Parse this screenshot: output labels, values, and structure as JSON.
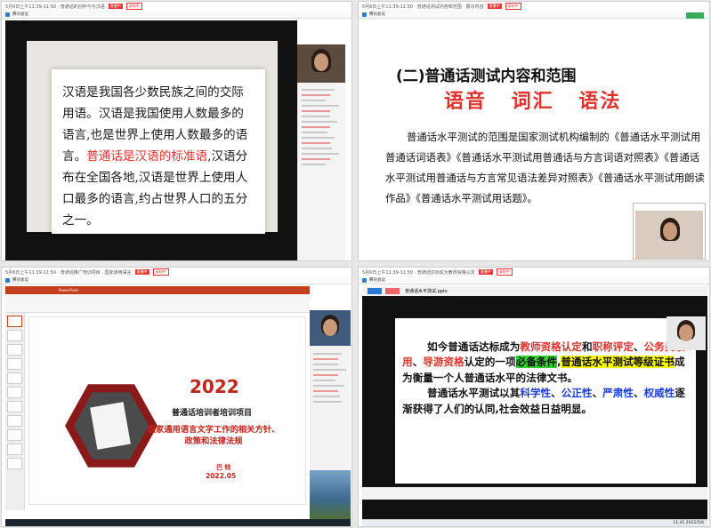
{
  "captions": {
    "q1": "5月6日上午11:39-11:50 · 普通话的创作与与汉语",
    "q1_tag": "直播中",
    "q1_tag2": "录制中",
    "q2": "5月6日上午11:39-11:50 · 普通话测试内容和范围 · 展示内容",
    "q2_tag": "直播中",
    "q2_tag2": "录制中",
    "q3": "5月6日上午11:39-11:50 · 普通话推广培训项目 · 国家通用语言",
    "q3_tag": "直播中",
    "q3_tag2": "录制中",
    "q4": "5月6日上午11:39-11:50 · 普通话达标成为教师资格认定",
    "q4_tag": "直播中",
    "q4_tag2": "录制中"
  },
  "window_title": "腾讯会议",
  "q1": {
    "lines": [
      {
        "text": "汉语是我国各少数民族之间的交际用",
        "red": false
      },
      {
        "text": "语。汉语是我国使用人数最多的语言,",
        "red": false
      },
      {
        "text": "也是世界上使用人数最多的语言。",
        "red": false
      },
      {
        "text_red": "普",
        "text": "",
        "red_end": true
      }
    ],
    "p1": "汉语是我国各少数民族之间的交际用语。汉语是我国使用人数最多的语言,也是世界上使用人数最多的语言。",
    "p1_red": "普通话是汉语的标准语",
    "p1_rest": ",汉语分布在全国各地,汉语是世界上使用人口最多的语言,约占世界人口的五分之一。"
  },
  "q2": {
    "title": "(二)普通话测试内容和范围",
    "big": "语音 词汇 语法",
    "para": "普通话水平测试的范围是国家测试机构编制的《普通话水平测试用普通话词语表》《普通话水平测试用普通话与方言词语对照表》《普通话水平测试用普通话与方言常见语法差异对照表》《普通话水平测试用朗读作品》《普通话水平测试用话题》。"
  },
  "q3": {
    "year": "2022",
    "project": "普通话培训者培训项目",
    "subtitle": "国家通用语言文字工作的相关方针、政策和法律法规",
    "author": "巴 特",
    "date": "2022.05",
    "app_title": "PowerPoint"
  },
  "q4": {
    "tab": "课件",
    "file": "普通话水平测试.pptx",
    "p1_a": "如今普通话达标成为",
    "p1_b": "教师资格认定",
    "p1_c": "和",
    "p1_d": "职称评定",
    "p1_e": "、",
    "p1_f": "公务员录用",
    "p1_g": "、",
    "p1_h": "导游资格",
    "p1_i": "认定的一项",
    "p1_j": "必备条件",
    "p1_k": ",",
    "p1_l": "普通话水平测试等级证书",
    "p1_m": "成为衡量一个人普通话水平的法律文书。",
    "p2_a": "普通话水平测试以其",
    "p2_b": "科学性",
    "p2_c": "、",
    "p2_d": "公正性",
    "p2_e": "、",
    "p2_f": "严肃性",
    "p2_g": "、",
    "p2_h": "权威性",
    "p2_i": "逐渐获得了人们的认同,社会效益日益明显。",
    "clock": "11:41",
    "date": "2022/5/6"
  },
  "colors": {
    "red": "#e0312b",
    "blue": "#1d3fd8",
    "green_highlight": "#2fd02f",
    "yellow_highlight": "#f5f500"
  }
}
